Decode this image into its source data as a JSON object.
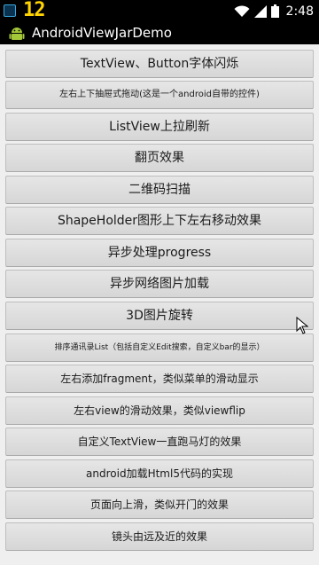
{
  "status_bar": {
    "counter": "12",
    "time": "2:48",
    "icons": [
      "app-notification-icon",
      "wifi-icon",
      "signal-icon",
      "battery-icon"
    ]
  },
  "action_bar": {
    "title": "AndroidViewJarDemo",
    "icon": "android-icon"
  },
  "buttons": [
    {
      "label": "TextView、Button字体闪烁"
    },
    {
      "label": "左右上下抽屉式拖动(这是一个android自带的控件)"
    },
    {
      "label": "ListView上拉刷新"
    },
    {
      "label": "翻页效果"
    },
    {
      "label": "二维码扫描"
    },
    {
      "label": "ShapeHolder图形上下左右移动效果"
    },
    {
      "label": "异步处理progress"
    },
    {
      "label": "异步网络图片加载"
    },
    {
      "label": "3D图片旋转"
    },
    {
      "label": "排序通讯录List（包括自定义Edit搜索，自定义bar的显示）"
    },
    {
      "label": "左右添加fragment，类似菜单的滑动显示"
    },
    {
      "label": "左右view的滑动效果，类似viewflip"
    },
    {
      "label": "自定义TextView一直跑马灯的效果"
    },
    {
      "label": "android加载Html5代码的实现"
    },
    {
      "label": "页面向上滑，类似开门的效果"
    },
    {
      "label": "镜头由远及近的效果"
    }
  ],
  "colors": {
    "background": "#efefef",
    "button": "#dedede",
    "status_bar": "#000000",
    "counter": "#ffd400",
    "accent": "#33b5e5"
  }
}
